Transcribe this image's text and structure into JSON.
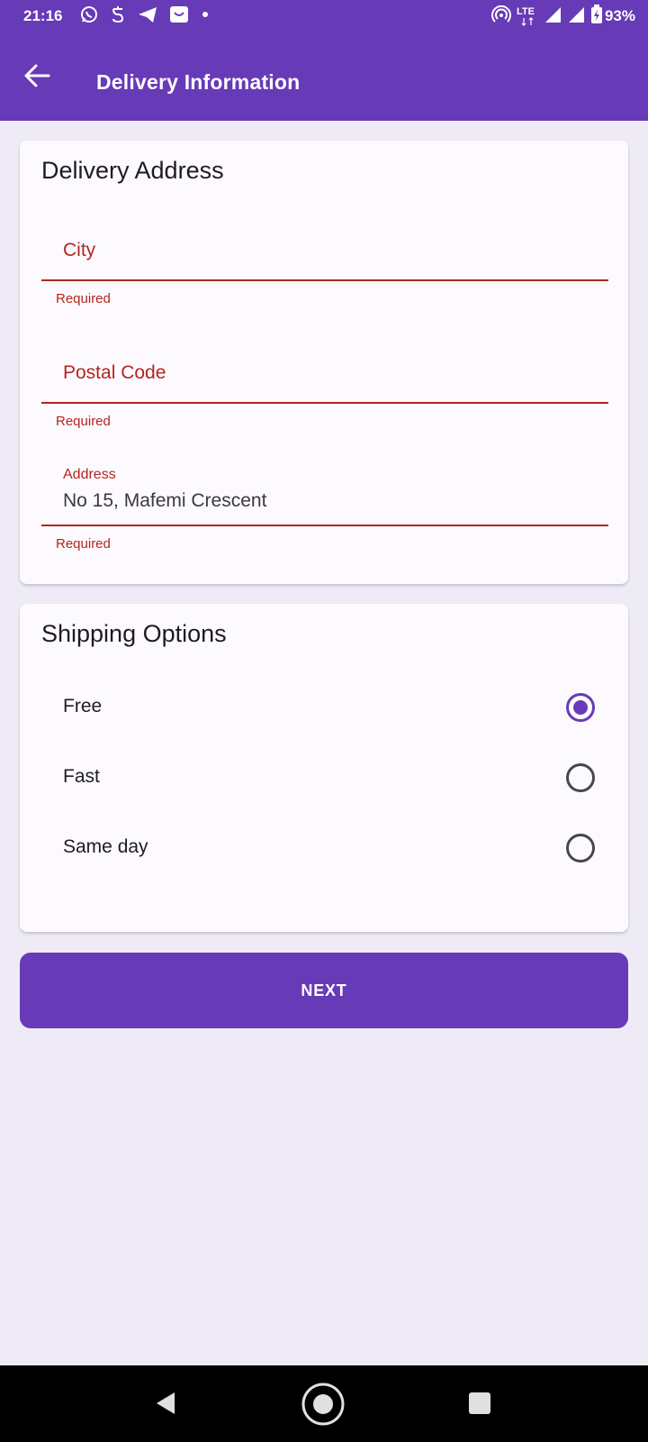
{
  "status_bar": {
    "time": "21:16",
    "battery_percent": "93%",
    "network_label": "LTE",
    "notification_icons": [
      "whatsapp-icon",
      "s-app-icon",
      "telegram-icon",
      "shop-icon",
      "dot-icon"
    ],
    "system_icons": [
      "hotspot-icon",
      "lte-icon",
      "signal-icon",
      "signal-icon",
      "battery-charging-icon"
    ]
  },
  "app_bar": {
    "title": "Delivery Information",
    "back_icon": "arrow-left-icon"
  },
  "delivery_address": {
    "title": "Delivery Address",
    "fields": [
      {
        "placeholder": "City",
        "value": "",
        "helper": "Required"
      },
      {
        "placeholder": "Postal Code",
        "value": "",
        "helper": "Required"
      },
      {
        "label": "Address",
        "value": "No 15, Mafemi Crescent",
        "helper": "Required"
      }
    ]
  },
  "shipping_options": {
    "title": "Shipping Options",
    "options": [
      {
        "label": "Free",
        "selected": true
      },
      {
        "label": "Fast",
        "selected": false
      },
      {
        "label": "Same day",
        "selected": false
      }
    ]
  },
  "next_button": {
    "label": "NEXT"
  },
  "nav_bar": {
    "icons": [
      "back-triangle-icon",
      "home-circle-icon",
      "recents-square-icon"
    ]
  },
  "colors": {
    "primary": "#673ab7",
    "error": "#b3261e",
    "background": "#eeebf7",
    "card": "#fdfaff"
  }
}
